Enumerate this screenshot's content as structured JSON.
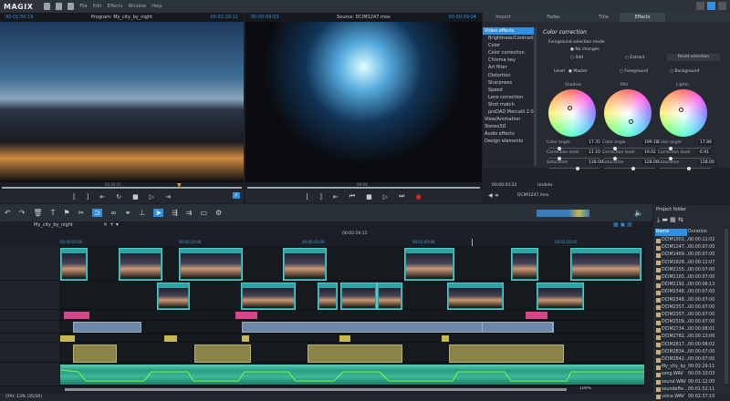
{
  "app": {
    "logo": "MAGIX",
    "menu": [
      "File",
      "Edit",
      "Effects",
      "Window",
      "Help"
    ]
  },
  "program": {
    "timecode_left": "00:01:50:19",
    "title": "Program: My_city_by_night",
    "timecode_right": "00:02:29:11",
    "scrub_time": "00:29:11"
  },
  "source": {
    "timecode_left": "00:00:09:03",
    "title": "Source: DCIM1247.mov",
    "timecode_right": "00:00:09:04",
    "scrub_time": "09:04"
  },
  "effects_panel": {
    "tabs": [
      "Import",
      "Fades",
      "Title",
      "Effects"
    ],
    "active_tab": "Effects",
    "categories": [
      "Video effects",
      "Brightness/Contrast",
      "Color",
      "Color correction",
      "Chroma key",
      "Art filter",
      "Distortion",
      "Sharpness",
      "Speed",
      "Lens correction",
      "Shot match",
      "proDAD Mercalli 2.0",
      "View/Animation",
      "Stereo3D",
      "Audio effects",
      "Design elements"
    ],
    "selected_category": "Video effects",
    "title": "Color correction",
    "fg_mode_label": "Foreground selection mode",
    "fg_options": [
      "No changes",
      "Add",
      "Extract"
    ],
    "reset_button": "Reset selection",
    "level_label": "Level",
    "level_options": [
      "Master",
      "Foreground",
      "Background"
    ],
    "wheels": [
      {
        "name": "Shadow",
        "color_angle": "17.35",
        "correction_level": "11.10",
        "saturation": "128.00"
      },
      {
        "name": "Mid",
        "color_angle": "199.18",
        "correction_level": "19.02",
        "saturation": "128.00"
      },
      {
        "name": "Lights",
        "color_angle": "17.88",
        "correction_level": "6.91",
        "saturation": "128.00"
      }
    ],
    "param_labels": {
      "angle": "Color angle",
      "level": "Correction level",
      "sat": "Saturation"
    },
    "bottom_time": "00:00:03:22",
    "undo": "Undo",
    "to": "to",
    "source_file": "DCIM1247.mov"
  },
  "timeline": {
    "project_tab": "My_city_by_night",
    "ruler_time": "00:02:29:11",
    "markers": [
      "00:00:00:00",
      "00:00:20:00",
      "00:00:40:00",
      "00:01:00:00",
      "00:01:20:00"
    ],
    "zoom": "100%",
    "status": "CPU: 13% (35/30)"
  },
  "project_folder": {
    "title": "Project folder",
    "col_name": "Name",
    "col_duration": "Duration",
    "items": [
      [
        "DCIM1001...",
        "00:00:11:02"
      ],
      [
        "DCIM1247...",
        "00:00:07:00"
      ],
      [
        "DCIM1469...",
        "00:00:07:00"
      ],
      [
        "DCIM1828...",
        "00:00:12:07"
      ],
      [
        "DCIM2155...",
        "00:00:07:00"
      ],
      [
        "DCIM2183...",
        "00:00:07:00"
      ],
      [
        "DCIM2192...",
        "00:00:06:13"
      ],
      [
        "DCIM2348...",
        "00:00:07:00"
      ],
      [
        "DCIM2348...",
        "00:00:07:00"
      ],
      [
        "DCIM2357...",
        "00:00:07:00"
      ],
      [
        "DCIM2357...",
        "00:00:07:00"
      ],
      [
        "DCIM2509...",
        "00:00:07:00"
      ],
      [
        "DCIM2734...",
        "00:00:08:01"
      ],
      [
        "DCIM2782...",
        "00:00:13:00"
      ],
      [
        "DCIM2817...",
        "00:00:08:02"
      ],
      [
        "DCIM2834...",
        "00:00:07:00"
      ],
      [
        "DCIM2842...",
        "00:00:07:00"
      ],
      [
        "My_city_by_n...",
        "00:02:29:11"
      ],
      [
        "song.WAV",
        "00:03:10:03"
      ],
      [
        "sound.WAV",
        "00:01:12:00"
      ],
      [
        "soundeffe...",
        "00:01:52:11"
      ],
      [
        "voice.WAV",
        "00:02:37:10"
      ]
    ]
  },
  "colors": {
    "accent": "#2f8fe0",
    "clip": "#2ba5a5",
    "title_clip": "#d4458a",
    "text_clip": "#c8b850",
    "audio": "#3cb89a",
    "envelope": "#7dff3c"
  }
}
